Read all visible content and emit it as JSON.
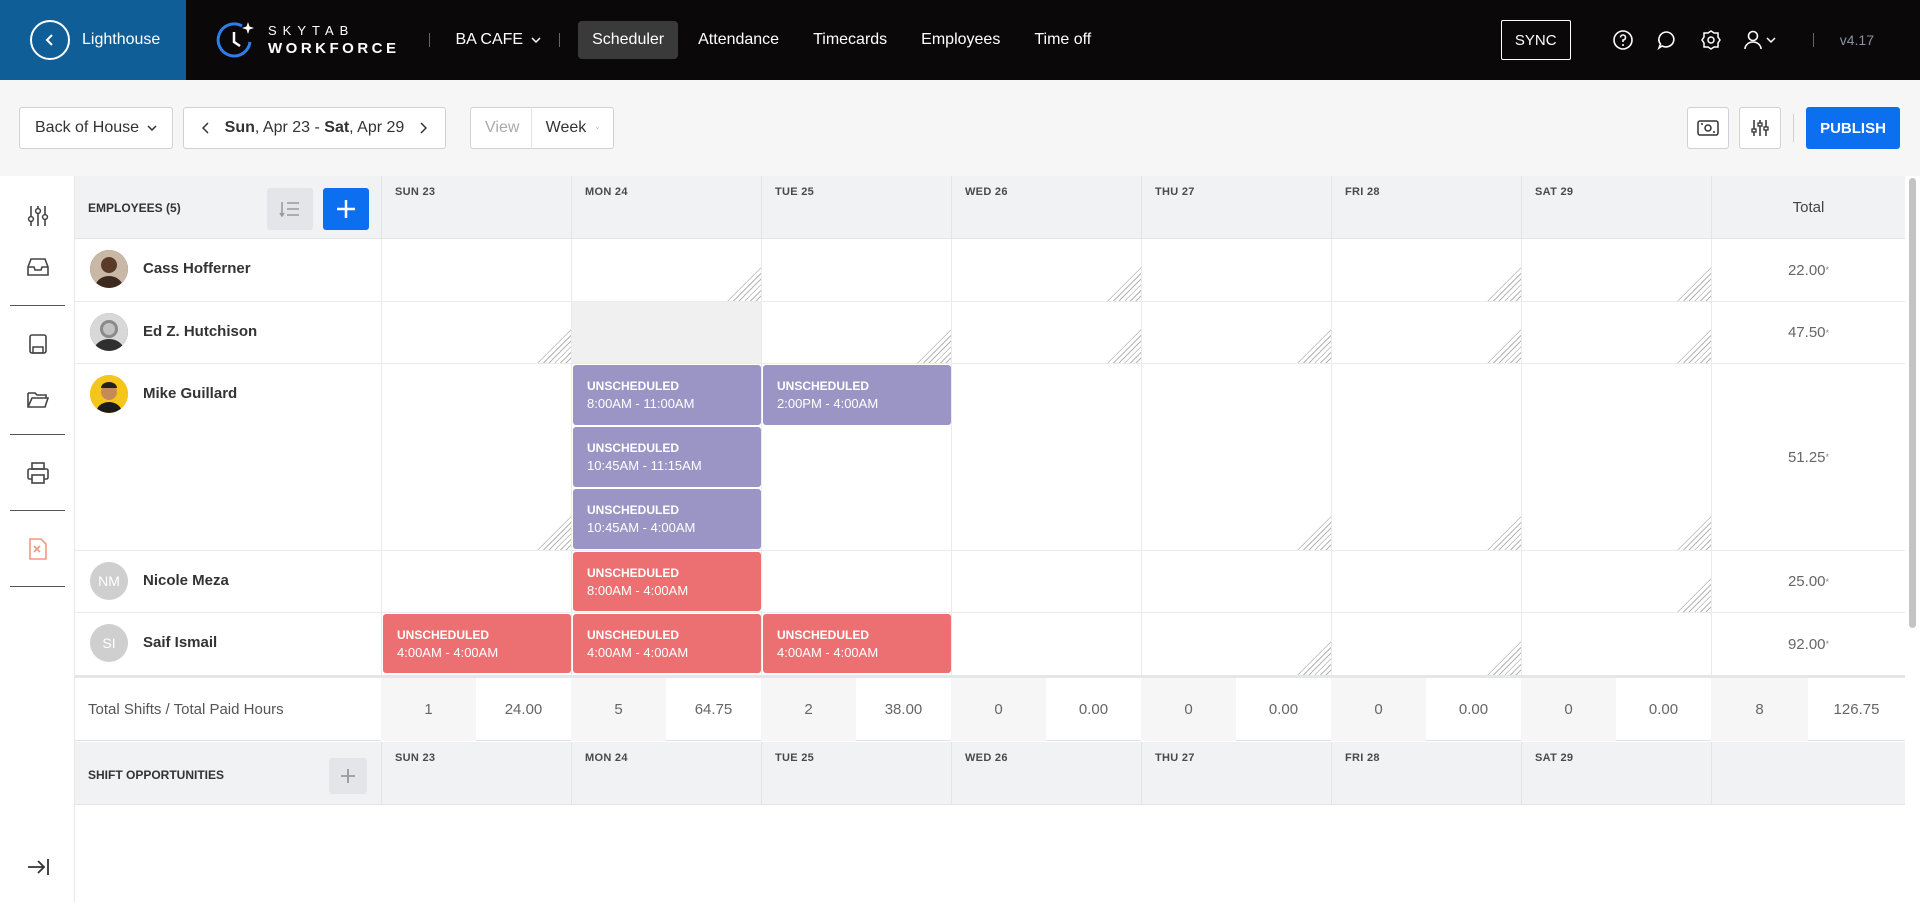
{
  "topbar": {
    "back_label": "Lighthouse",
    "brand_line1": "SKYTAB",
    "brand_line2": "WORKFORCE",
    "store_name": "BA CAFE",
    "nav": [
      {
        "label": "Scheduler",
        "active": true
      },
      {
        "label": "Attendance",
        "active": false
      },
      {
        "label": "Timecards",
        "active": false
      },
      {
        "label": "Employees",
        "active": false
      },
      {
        "label": "Time off",
        "active": false
      }
    ],
    "sync_label": "SYNC",
    "version": "v4.17"
  },
  "toolbar": {
    "department": "Back of House",
    "date_start_day": "Sun",
    "date_start": ", Apr 23 - ",
    "date_end_day": "Sat",
    "date_end": ", Apr 29",
    "view_label": "View",
    "view_value": "Week",
    "publish_label": "PUBLISH"
  },
  "grid": {
    "employees_header": "EMPLOYEES (5)",
    "total_header": "Total",
    "days": [
      "SUN 23",
      "MON 24",
      "TUE 25",
      "WED 26",
      "THU 27",
      "FRI 28",
      "SAT 29"
    ],
    "employees": [
      {
        "name": "Cass Hofferner",
        "initials": "",
        "total": "22.00",
        "total_mark": "*"
      },
      {
        "name": "Ed Z. Hutchison",
        "initials": "",
        "total": "47.50",
        "total_mark": "*"
      },
      {
        "name": "Mike Guillard",
        "initials": "",
        "total": "51.25",
        "total_mark": "*"
      },
      {
        "name": "Nicole Meza",
        "initials": "NM",
        "total": "25.00",
        "total_mark": "*"
      },
      {
        "name": "Saif Ismail",
        "initials": "SI",
        "total": "92.00",
        "total_mark": "*"
      }
    ],
    "shifts": {
      "mike": [
        {
          "title": "UNSCHEDULED",
          "time": "8:00AM - 11:00AM"
        },
        {
          "title": "UNSCHEDULED",
          "time": "10:45AM - 11:15AM"
        },
        {
          "title": "UNSCHEDULED",
          "time": "10:45AM - 4:00AM"
        },
        {
          "title": "UNSCHEDULED",
          "time": "2:00PM - 4:00AM"
        }
      ],
      "nicole": [
        {
          "title": "UNSCHEDULED",
          "time": "8:00AM - 4:00AM"
        }
      ],
      "saif": [
        {
          "title": "UNSCHEDULED",
          "time": "4:00AM - 4:00AM"
        },
        {
          "title": "UNSCHEDULED",
          "time": "4:00AM - 4:00AM"
        },
        {
          "title": "UNSCHEDULED",
          "time": "4:00AM - 4:00AM"
        }
      ]
    },
    "totals_label": "Total Shifts / Total Paid Hours",
    "totals": [
      {
        "shifts": "1",
        "hours": "24.00"
      },
      {
        "shifts": "5",
        "hours": "64.75"
      },
      {
        "shifts": "2",
        "hours": "38.00"
      },
      {
        "shifts": "0",
        "hours": "0.00"
      },
      {
        "shifts": "0",
        "hours": "0.00"
      },
      {
        "shifts": "0",
        "hours": "0.00"
      },
      {
        "shifts": "0",
        "hours": "0.00"
      },
      {
        "shifts": "8",
        "hours": "126.75"
      }
    ],
    "opportunities_header": "SHIFT OPPORTUNITIES"
  },
  "colors": {
    "topbar": "#0b0809",
    "lighthouse": "#0f5e97",
    "primary": "#0b6ff0",
    "shift_purple": "#9a95c4",
    "shift_red": "#ec6f72"
  }
}
